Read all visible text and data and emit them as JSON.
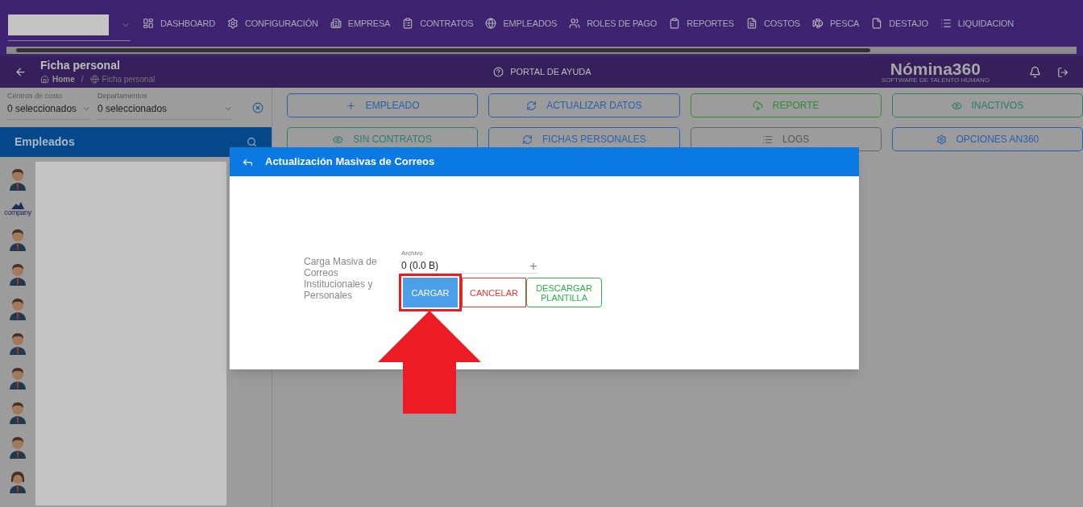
{
  "nav": {
    "items": [
      "DASHBOARD",
      "CONFIGURACIÓN",
      "EMPRESA",
      "CONTRATOS",
      "EMPLEADOS",
      "ROLES DE PAGO",
      "REPORTES",
      "COSTOS",
      "PESCA",
      "DESTAJO",
      "LIQUIDACION"
    ]
  },
  "header": {
    "title": "Ficha personal",
    "breadcrumb": [
      "Home",
      "Ficha personal"
    ],
    "breadcrumb_separator": "/",
    "help": "PORTAL DE AYUDA",
    "logo": "Nómina360",
    "logo_tagline": "SOFTWARE DE TALENTO HUMANO"
  },
  "filters": [
    {
      "label": "Centros de costo",
      "value": "0 seleccionados"
    },
    {
      "label": "Departamentos",
      "value": "0 seleccionados"
    }
  ],
  "employees": {
    "title": "Empleados",
    "avatars": [
      {
        "kind": "male"
      },
      {
        "kind": "company",
        "text": "company"
      },
      {
        "kind": "male"
      },
      {
        "kind": "male"
      },
      {
        "kind": "male"
      },
      {
        "kind": "male"
      },
      {
        "kind": "male"
      },
      {
        "kind": "male"
      },
      {
        "kind": "male"
      },
      {
        "kind": "female"
      }
    ]
  },
  "actions": [
    {
      "label": "EMPLEADO",
      "kind": "blue"
    },
    {
      "label": "ACTUALIZAR DATOS",
      "kind": "blue"
    },
    {
      "label": "REPORTE",
      "kind": "green"
    },
    {
      "label": "INACTIVOS",
      "kind": "teal"
    },
    {
      "label": "SIN CONTRATOS",
      "kind": "teal"
    },
    {
      "label": "FICHAS PERSONALES",
      "kind": "blue"
    },
    {
      "label": "LOGS",
      "kind": "grey"
    },
    {
      "label": "OPCIONES AN360",
      "kind": "blue"
    }
  ],
  "dialog": {
    "title": "Actualización Masivas de Correos",
    "field_label": "Carga Masiva de Correos Institucionales y Personales",
    "file_label": "Archivo",
    "file_value": "0 (0.0 B)",
    "add": "+",
    "buttons": [
      {
        "label": "CARGAR",
        "kind": "primary",
        "highlighted": true
      },
      {
        "label": "CANCELAR",
        "kind": "danger",
        "highlighted": false
      },
      {
        "label": "DESCARGAR PLANTILLA",
        "kind": "success",
        "highlighted": false
      }
    ]
  }
}
